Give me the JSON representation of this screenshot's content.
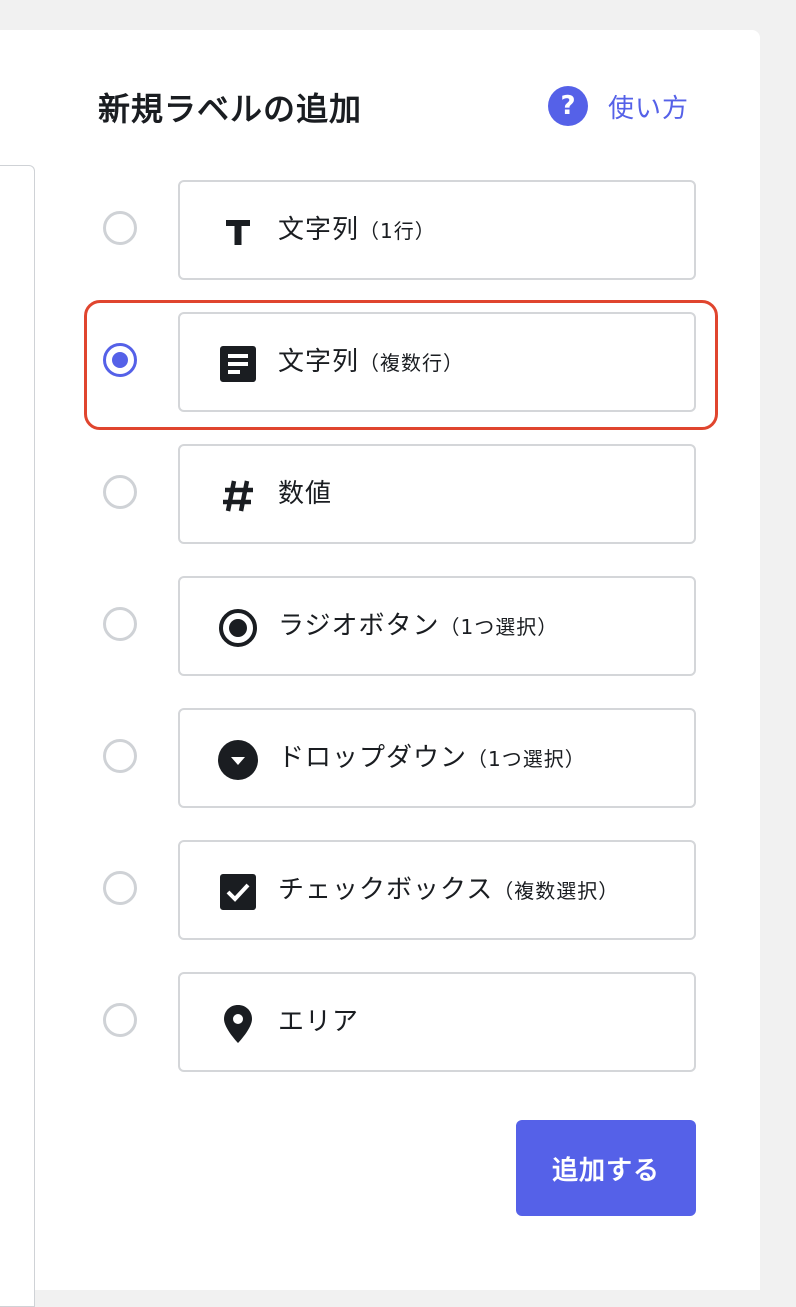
{
  "dialog": {
    "title": "新規ラベルの追加",
    "help": {
      "icon": "question-circle-icon",
      "label": "使い方"
    },
    "submit_label": "追加する"
  },
  "options": [
    {
      "icon": "text-icon",
      "label": "文字列",
      "sub": "（1行）",
      "selected": false
    },
    {
      "icon": "paragraph-icon",
      "label": "文字列",
      "sub": "（複数行）",
      "selected": true
    },
    {
      "icon": "hash-icon",
      "label": "数値",
      "sub": "",
      "selected": false
    },
    {
      "icon": "radio-button-icon",
      "label": "ラジオボタン",
      "sub": "（1つ選択）",
      "selected": false
    },
    {
      "icon": "dropdown-icon",
      "label": "ドロップダウン",
      "sub": "（1つ選択）",
      "selected": false
    },
    {
      "icon": "checkbox-icon",
      "label": "チェックボックス",
      "sub": "（複数選択）",
      "selected": false
    },
    {
      "icon": "map-pin-icon",
      "label": "エリア",
      "sub": "",
      "selected": false
    }
  ],
  "colors": {
    "accent": "#5561e8",
    "highlight_outline": "#e0452e",
    "border": "#d4d6d9",
    "text": "#1a1d21"
  }
}
